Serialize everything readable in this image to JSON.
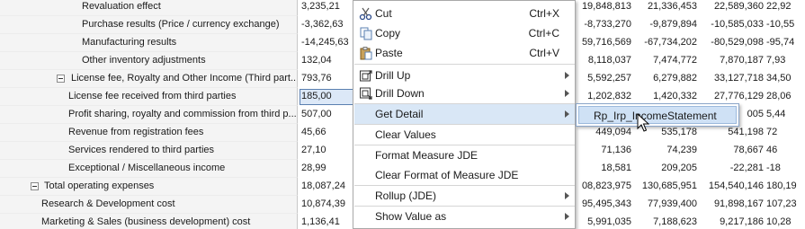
{
  "rows": [
    {
      "label": "Revaluation effect",
      "c1": "3,235,21",
      "c2": "19,848,813",
      "c3": "21,336,453",
      "c4": "22,589,360",
      "c5": "22,92"
    },
    {
      "label": "Purchase results (Price / currency exchange)",
      "c1": "-3,362,63",
      "c2": "-8,733,270",
      "c3": "-9,879,894",
      "c4": "-10,585,033",
      "c5": "-10,55"
    },
    {
      "label": "Manufacturing results",
      "c1": "-14,245,63",
      "c2": "59,716,569",
      "c3": "-67,734,202",
      "c4": "-80,529,098",
      "c5": "-95,74"
    },
    {
      "label": "Other inventory adjustments",
      "c1": "132,04",
      "c2": "8,118,037",
      "c3": "7,474,772",
      "c4": "7,870,187",
      "c5": "7,93"
    },
    {
      "label": "License fee, Royalty and Other Income (Third part...",
      "c1": "793,76",
      "c2": "5,592,257",
      "c3": "6,279,882",
      "c4": "33,127,718",
      "c5": "34,50"
    },
    {
      "label": "License fee received from third parties",
      "c1": "185,00",
      "c2": "1,202,832",
      "c3": "1,420,332",
      "c4": "27,776,129",
      "c5": "28,06"
    },
    {
      "label": "Profit sharing, royalty and commission from third p...",
      "c1": "507,00",
      "c2": "",
      "c3": "",
      "c4": "005",
      "c5": "5,44"
    },
    {
      "label": "Revenue from registration fees",
      "c1": "45,66",
      "c2": "449,094",
      "c3": "535,178",
      "c4": "541,198",
      "c5": "72"
    },
    {
      "label": "Services rendered to third parties",
      "c1": "27,10",
      "c2": "71,136",
      "c3": "74,239",
      "c4": "78,667",
      "c5": "46"
    },
    {
      "label": "Exceptional / Miscellaneous income",
      "c1": "28,99",
      "c2": "18,581",
      "c3": "209,205",
      "c4": "-22,281",
      "c5": "-18"
    },
    {
      "label": "Total operating expenses",
      "c1": "18,087,24",
      "c2": "08,823,975",
      "c3": "130,685,951",
      "c4": "154,540,146",
      "c5": "180,19"
    },
    {
      "label": "Research & Development cost",
      "c1": "10,874,39",
      "c2": "95,495,343",
      "c3": "77,939,400",
      "c4": "91,898,167",
      "c5": "107,23"
    },
    {
      "label": "Marketing & Sales (business development) cost",
      "c1": "1,136,41",
      "c2": "5,991,035",
      "c3": "7,188,623",
      "c4": "9,217,186",
      "c5": "10,28"
    }
  ],
  "menu": {
    "cut": {
      "label": "Cut",
      "shortcut": "Ctrl+X",
      "icon": "scissors-icon"
    },
    "copy": {
      "label": "Copy",
      "shortcut": "Ctrl+C",
      "icon": "copy-icon"
    },
    "paste": {
      "label": "Paste",
      "shortcut": "Ctrl+V",
      "icon": "paste-icon"
    },
    "drill_up": {
      "label": "Drill Up",
      "icon": "drill-up-icon"
    },
    "drill_down": {
      "label": "Drill Down",
      "icon": "drill-down-icon"
    },
    "get_detail": {
      "label": "Get Detail"
    },
    "clear_values": {
      "label": "Clear Values"
    },
    "format_measure": {
      "label": "Format Measure JDE"
    },
    "clear_format": {
      "label": "Clear Format of Measure JDE"
    },
    "rollup": {
      "label": "Rollup (JDE)"
    },
    "show_value_as": {
      "label": "Show Value as"
    }
  },
  "submenu": {
    "item": "Rp_Irp_IncomeStatement"
  },
  "colors": {
    "highlight": "#d9e7f6",
    "label_bg": "#f4f4f4",
    "selected_cell": "#dce8f7"
  }
}
